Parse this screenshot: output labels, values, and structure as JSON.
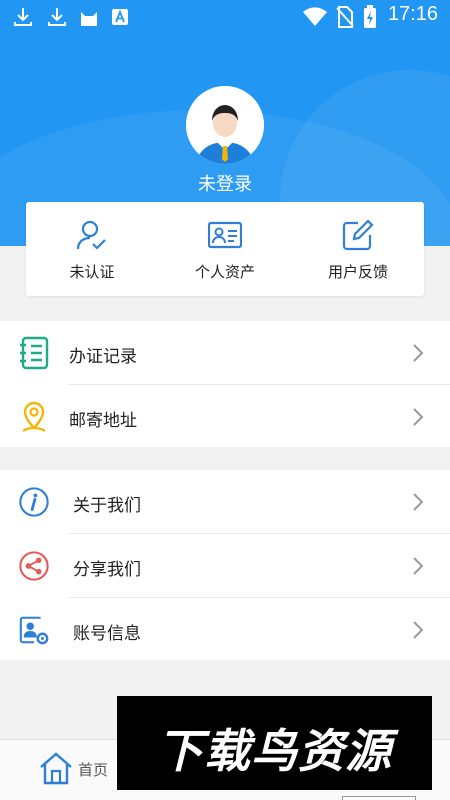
{
  "status_bar": {
    "time": "17:16",
    "left_icons": [
      "download-icon",
      "download-icon",
      "cat-icon",
      "font-a-icon"
    ],
    "right_icons": [
      "wifi-icon",
      "no-sim-icon",
      "battery-charging-icon"
    ]
  },
  "profile": {
    "login_status": "未登录",
    "avatar_icon": "user-avatar-icon"
  },
  "quick_actions": [
    {
      "label": "未认证",
      "icon": "verify-user-icon"
    },
    {
      "label": "个人资产",
      "icon": "id-card-icon"
    },
    {
      "label": "用户反馈",
      "icon": "edit-feedback-icon"
    }
  ],
  "menu_group_1": [
    {
      "label": "办证记录",
      "icon": "notebook-icon",
      "icon_color": "#1fab89"
    },
    {
      "label": "邮寄地址",
      "icon": "location-pin-icon",
      "icon_color": "#f2b705"
    }
  ],
  "menu_group_2": [
    {
      "label": "关于我们",
      "icon": "info-icon",
      "icon_color": "#2f7fd6"
    },
    {
      "label": "分享我们",
      "icon": "share-icon",
      "icon_color": "#e45b5b"
    },
    {
      "label": "账号信息",
      "icon": "account-settings-icon",
      "icon_color": "#2f7fd6"
    }
  ],
  "bottom_nav": {
    "home_label": "首页"
  },
  "watermark": {
    "text": "下载鸟资源"
  },
  "colors": {
    "header_blue": "#2196f3",
    "background": "#f2f2f2",
    "accent_blue": "#2f7fd6"
  }
}
